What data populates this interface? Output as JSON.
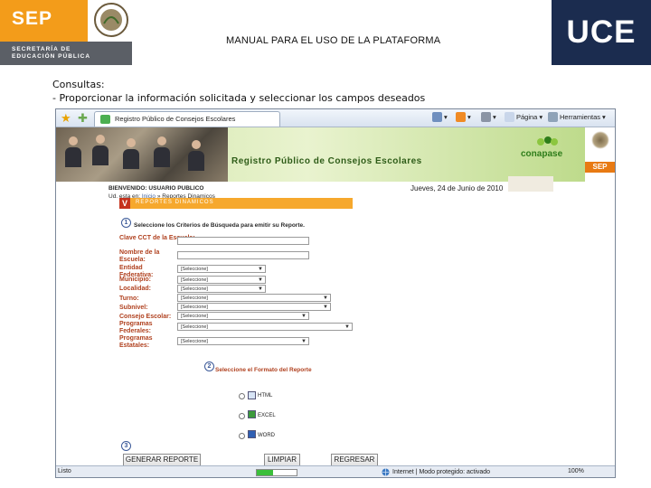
{
  "header": {
    "sep_logo": "SEP",
    "sep_line1": "SECRETARÍA DE",
    "sep_line2": "EDUCACIÓN PÚBLICA",
    "title": "MANUAL PARA EL USO DE LA PLATAFORMA",
    "uce_logo": "UCE"
  },
  "captions": {
    "line1": "Consultas:",
    "line2": "- Proporcionar la información solicitada y seleccionar los campos deseados"
  },
  "browser": {
    "tab_title": "Registro Público de Consejos Escolares",
    "commands": {
      "page": "Página",
      "tools": "Herramientas"
    },
    "status": {
      "ready": "Listo",
      "progress": 0.4,
      "zone": "Internet | Modo protegido: activado",
      "zoom": "100%"
    }
  },
  "site": {
    "banner_title": "Registro Público de Consejos Escolares",
    "conapase": "conapase",
    "sep": "SEP",
    "welcome": "BIENVENIDO: USUARIO PUBLICO",
    "crumb_prefix": "Ud. esta en:",
    "crumb_home": "Inicio",
    "crumb_current": "» Reportes Dinamicos",
    "date": "Jueves, 24 de Junio de 2010",
    "section_title": "REPORTES DINAMICOS",
    "step1_number": "1",
    "step1_text": "Seleccione los Criterios de Búsqueda para emitir su Reporte.",
    "fields": {
      "cct_label": "Clave CCT de la Escuela:",
      "name_label": "Nombre de la Escuela:",
      "entidad_label": "Entidad Federativa:",
      "municipio_label": "Municipio:",
      "localidad_label": "Localidad:",
      "turno_label": "Turno:",
      "subnivel_label": "Subnivel:",
      "consejo_label": "Consejo Escolar:",
      "prog_fed_label": "Programas Federales:",
      "prog_est_label": "Programas Estatales:",
      "select_value": "[Seleccione]"
    },
    "step2_number": "2",
    "step2_text": "Seleccione el Formato del Reporte",
    "formats": [
      "HTML",
      "EXCEL",
      "WORD"
    ],
    "step3_number": "3",
    "buttons": {
      "generate": "GENERAR REPORTE",
      "clear": "LIMPIAR",
      "back": "REGRESAR"
    }
  }
}
